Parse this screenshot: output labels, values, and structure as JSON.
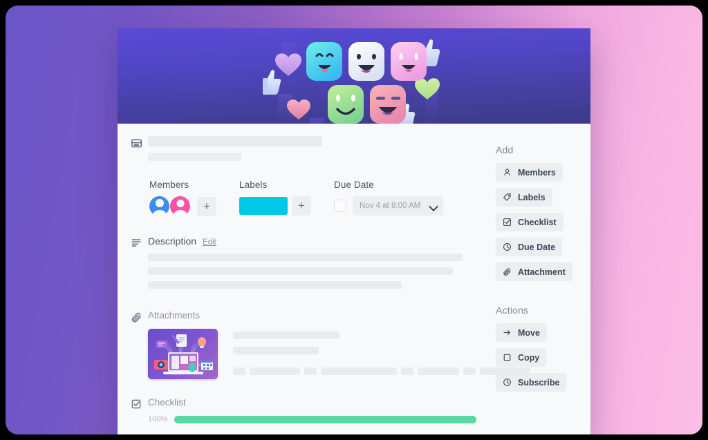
{
  "theme": {
    "bg_gradient_from": "#6a55c8",
    "bg_gradient_to": "#fbbde5",
    "banner_top": "#5a4ad6",
    "banner_bottom": "#3b3a86",
    "card_bg": "#f8f9fb",
    "label_chip_color": "#00c8e6",
    "progress_color": "#57d9a3",
    "avatar_1_color": "#3b8ef4",
    "avatar_2_color": "#fb52a8"
  },
  "banner": {
    "alt": "reaction emoji illustration",
    "emojis": [
      {
        "name": "grin-face",
        "color_a": "#62e6e8",
        "color_b": "#38c9f0"
      },
      {
        "name": "laugh-face",
        "color_a": "#ffffff",
        "color_b": "#dfe4f2"
      },
      {
        "name": "surprised-face",
        "color_a": "#ffc8ef",
        "color_b": "#f0a6e4"
      },
      {
        "name": "smile-face",
        "color_a": "#b9e9a0",
        "color_b": "#8fd98e"
      },
      {
        "name": "smirk-face",
        "color_a": "#f7a6b4",
        "color_b": "#ef8fa7"
      }
    ],
    "hearts": [
      {
        "name": "heart-purple",
        "color": "#d3a8f0"
      },
      {
        "name": "heart-pink",
        "color": "#f09ab4"
      },
      {
        "name": "heart-green",
        "color": "#c3e89a"
      }
    ],
    "thumbs": [
      {
        "name": "thumbs-up-left"
      },
      {
        "name": "thumbs-up-mid"
      },
      {
        "name": "thumbs-up-right"
      },
      {
        "name": "thumbs-up-far-right"
      }
    ]
  },
  "card_header": {
    "icon": "card-window-icon",
    "title_placeholder": "",
    "subtitle_placeholder": ""
  },
  "meta": {
    "members": {
      "label": "Members",
      "avatars": [
        "member-avatar-blue",
        "member-avatar-pink"
      ],
      "add_label": "+"
    },
    "labels": {
      "label": "Labels",
      "chip_color": "#00c8e6",
      "add_label": "+"
    },
    "due_date": {
      "label": "Due Date",
      "checkbox_checked": false,
      "value": "Nov 4 at 8:00 AM",
      "chevron": "chevron-down-icon"
    }
  },
  "description": {
    "icon": "description-lines-icon",
    "title": "Description",
    "edit_label": "Edit",
    "line_widths": [
      "455px",
      "441px",
      "367px"
    ]
  },
  "attachments": {
    "icon": "paperclip-icon",
    "title": "Attachments",
    "thumbnail_name": "attachment-thumbnail-laptop-illustration",
    "tag_widths": [
      "18px",
      "73px",
      "18px",
      "110px",
      "18px",
      "60px",
      "18px",
      "73px"
    ]
  },
  "checklist": {
    "icon": "checkbox-checked-icon",
    "title": "Checklist",
    "percent_label": "100%",
    "percent_value": 100
  },
  "sidebar": {
    "add": {
      "heading": "Add",
      "items": [
        {
          "label": "Members",
          "icon": "person-icon"
        },
        {
          "label": "Labels",
          "icon": "tag-icon"
        },
        {
          "label": "Checklist",
          "icon": "checkbox-checked-icon"
        },
        {
          "label": "Due Date",
          "icon": "clock-icon"
        },
        {
          "label": "Attachment",
          "icon": "paperclip-icon"
        }
      ]
    },
    "actions": {
      "heading": "Actions",
      "items": [
        {
          "label": "Move",
          "icon": "arrow-right-icon"
        },
        {
          "label": "Copy",
          "icon": "square-icon"
        },
        {
          "label": "Subscribe",
          "icon": "bell-icon"
        }
      ]
    }
  }
}
